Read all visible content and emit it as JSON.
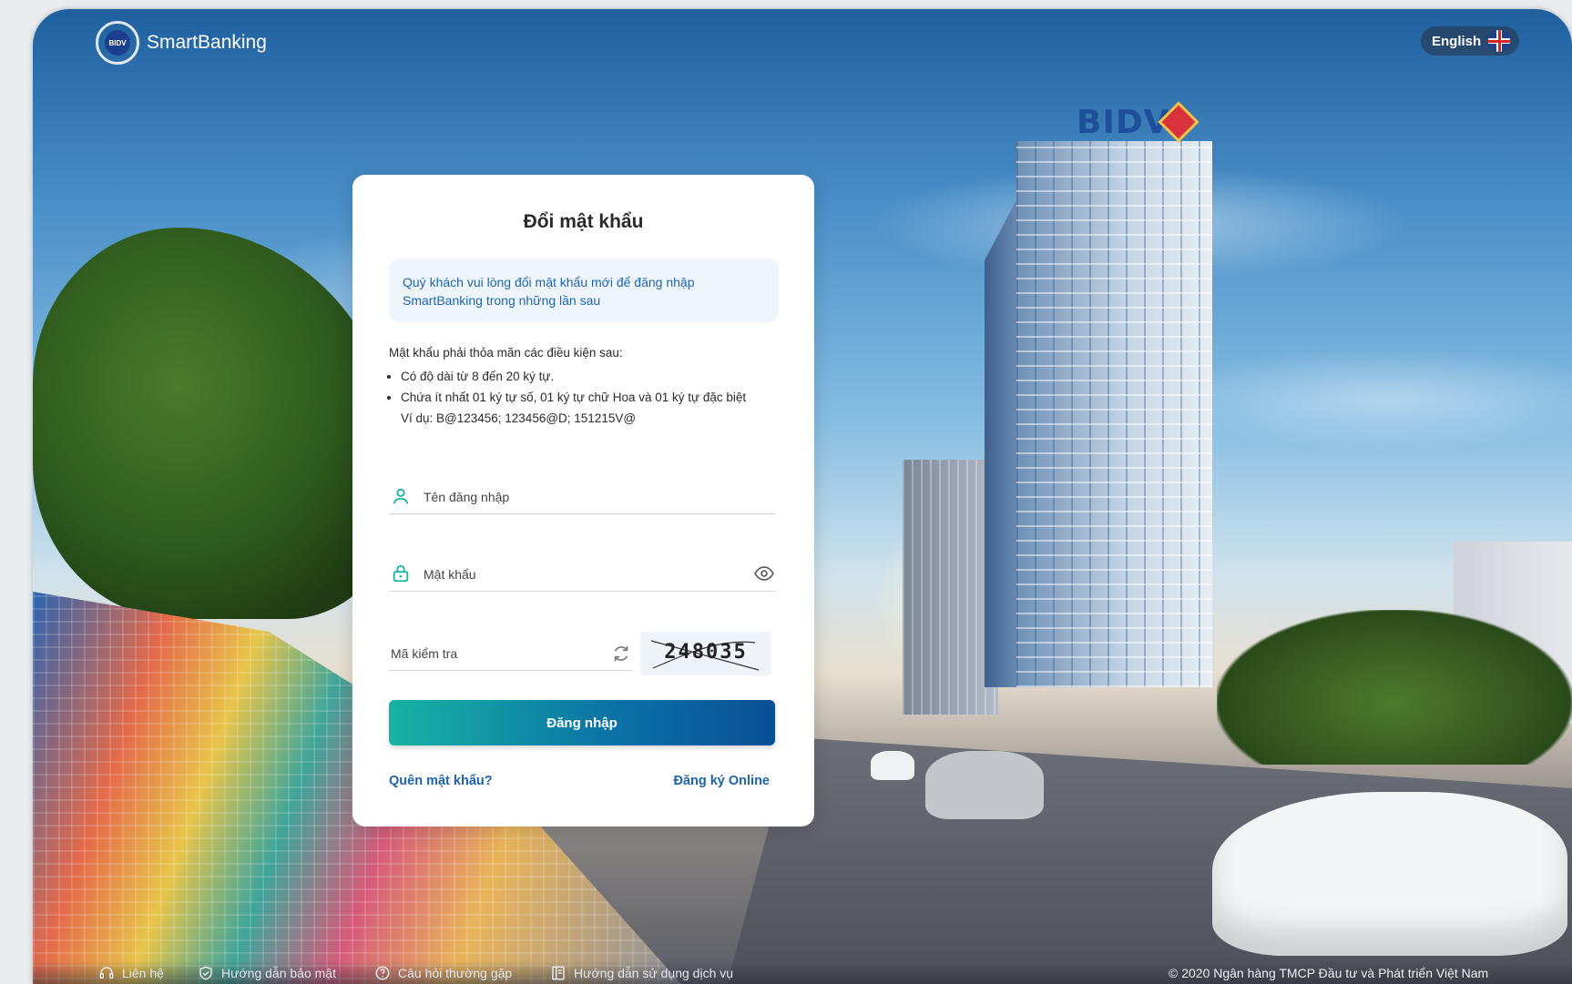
{
  "header": {
    "logo_text": "SmartBanking",
    "logo_badge": "BIDV",
    "language_label": "English"
  },
  "background": {
    "sign_text": "BIDV"
  },
  "card": {
    "title": "Đổi mật khẩu",
    "notice": "Quý khách vui lòng đổi mật khẩu mới để đăng nhập SmartBanking trong những lần sau",
    "rules_heading": "Mật khẩu phải thỏa mãn các điều kiện sau:",
    "rules": [
      "Có độ dài từ 8 đến 20 ký tự.",
      "Chứa ít nhất 01 ký tự số, 01 ký tự chữ Hoa và 01 ký tự đặc biệt"
    ],
    "example": "Ví dụ: B@123456; 123456@D; 151215V@",
    "username_placeholder": "Tên đăng nhập",
    "password_placeholder": "Mật khẩu",
    "captcha_placeholder": "Mã kiểm tra",
    "captcha_code": "248035",
    "login_label": "Đăng nhập",
    "forgot_label": "Quên mật khẩu?",
    "register_label": "Đăng ký Online"
  },
  "footer": {
    "links": [
      {
        "label": "Liên hệ",
        "icon": "headset-icon"
      },
      {
        "label": "Hướng dẫn bảo mật",
        "icon": "shield-check-icon"
      },
      {
        "label": "Câu hỏi thường gặp",
        "icon": "question-circle-icon"
      },
      {
        "label": "Hướng dẫn sử dụng dịch vụ",
        "icon": "book-icon"
      }
    ],
    "copyright": "© 2020 Ngân hàng TMCP Đầu tư và Phát triển Việt Nam"
  },
  "colors": {
    "accent_blue": "#1e63a8",
    "button_start": "#17b3a3",
    "button_end": "#0a4f96",
    "notice_bg": "#eef6fc"
  }
}
